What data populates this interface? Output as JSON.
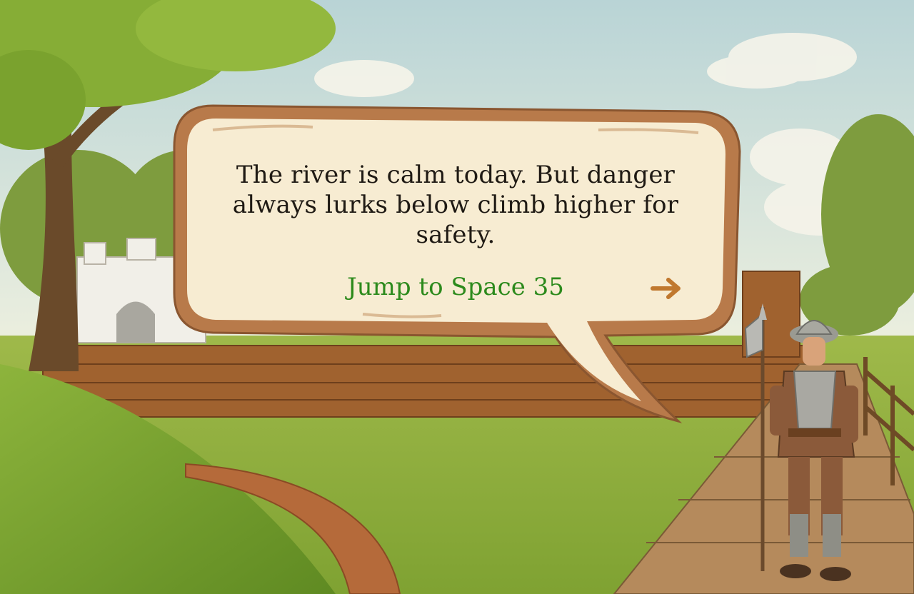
{
  "dialogue": {
    "text": "The river is calm today. But danger always lurks below climb higher for safety.",
    "action_label": "Jump to Space 35",
    "next_icon": "arrow-right-icon"
  },
  "colors": {
    "action_text": "#2c8a1c",
    "arrow": "#c0782e",
    "bubble_fill": "#f7ecd2",
    "bubble_border": "#b87a4a",
    "dialogue_text": "#1f1a14"
  }
}
